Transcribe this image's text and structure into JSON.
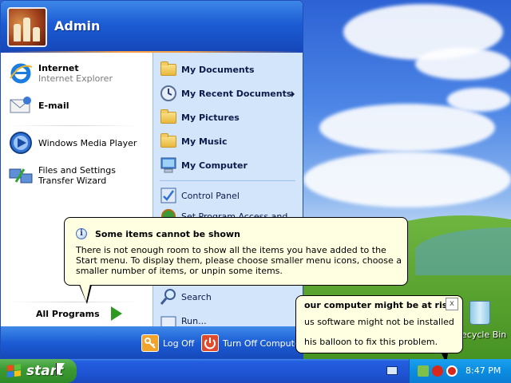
{
  "start_menu": {
    "user_name": "Admin",
    "pinned": [
      {
        "title": "Internet",
        "subtitle": "Internet Explorer",
        "icon": "internet-explorer-icon"
      },
      {
        "title": "E-mail",
        "icon": "email-icon"
      }
    ],
    "recent": [
      {
        "label": "Windows Media Player",
        "icon": "media-player-icon"
      },
      {
        "label": "Files and Settings Transfer Wizard",
        "icon": "transfer-wizard-icon"
      }
    ],
    "all_programs": "All Programs",
    "right": [
      {
        "label": "My Documents",
        "icon": "folder-icon"
      },
      {
        "label": "My Recent Documents",
        "icon": "recent-documents-icon"
      },
      {
        "label": "My Pictures",
        "icon": "folder-icon"
      },
      {
        "label": "My Music",
        "icon": "folder-icon"
      },
      {
        "label": "My Computer",
        "icon": "computer-icon"
      },
      {
        "label": "Control Panel",
        "icon": "control-panel-icon"
      },
      {
        "label": "Set Program Access and",
        "icon": "program-access-icon"
      },
      {
        "label": "Search",
        "icon": "search-icon"
      },
      {
        "label": "Run...",
        "icon": "run-icon"
      }
    ],
    "log_off": "Log Off",
    "turn_off": "Turn Off Computer"
  },
  "balloon": {
    "title": "Some items cannot be shown",
    "body": "There is not enough room to show all the items you have added to the Start menu. To display them, please choose smaller menu icons, choose a smaller number of items, or unpin some items."
  },
  "risk_balloon": {
    "title": "our computer might be at risk",
    "line1": "us software might not be installed",
    "line2": "his balloon to fix this problem.",
    "close": "x"
  },
  "desktop": {
    "recycle_bin": "ecycle Bin"
  },
  "taskbar": {
    "start_label": "start",
    "clock": "8:47 PM"
  },
  "colors": {
    "taskbar_blue": "#245ee0",
    "start_green": "#3c9a33",
    "tray_blue": "#0c8de0",
    "balloon_yellow": "#ffffe1"
  }
}
